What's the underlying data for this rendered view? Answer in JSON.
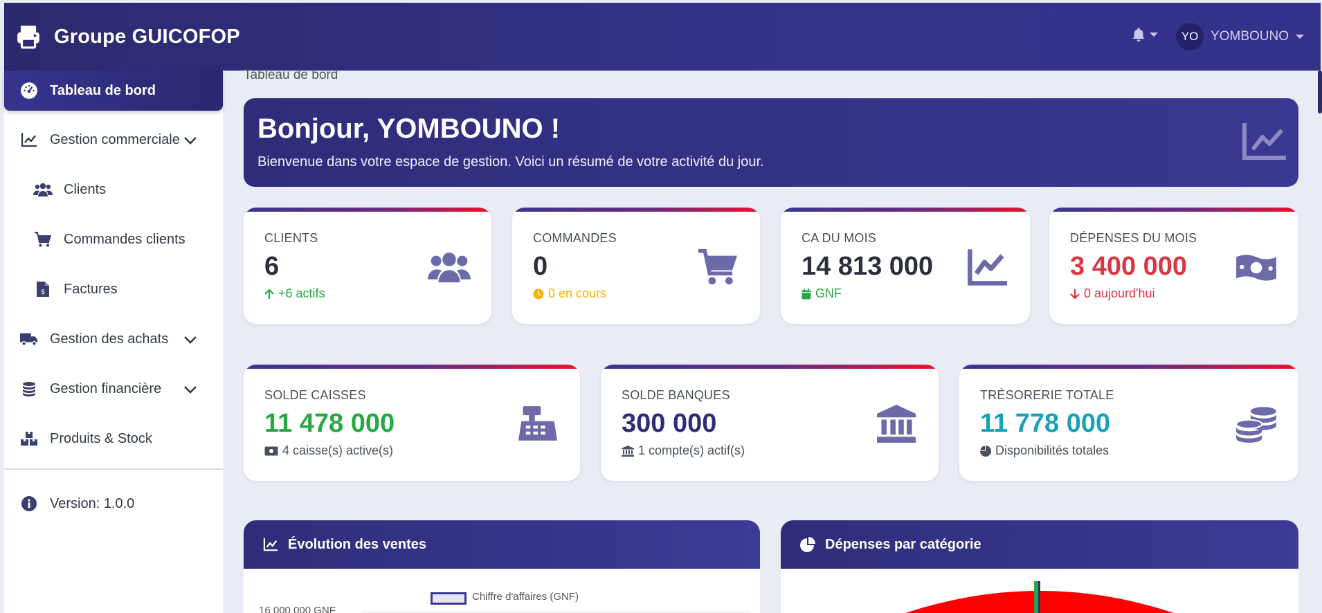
{
  "app": {
    "brand": "Groupe GUICOFOP",
    "user_initials": "YO",
    "user_name": "YOMBOUNO"
  },
  "sidebar": {
    "active": "Tableau de bord",
    "items": [
      {
        "label": "Gestion commerciale",
        "icon": "chart-line-icon"
      },
      {
        "label": "Clients",
        "icon": "users-icon"
      },
      {
        "label": "Commandes clients",
        "icon": "cart-icon"
      },
      {
        "label": "Factures",
        "icon": "invoice-icon"
      },
      {
        "label": "Gestion des achats",
        "icon": "truck-icon"
      },
      {
        "label": "Gestion financière",
        "icon": "coins-icon"
      },
      {
        "label": "Produits & Stock",
        "icon": "boxes-icon"
      }
    ],
    "version": "Version: 1.0.0"
  },
  "breadcrumb": "Tableau de bord",
  "hero": {
    "title": "Bonjour, YOMBOUNO !",
    "subtitle": "Bienvenue dans votre espace de gestion. Voici un résumé de votre activité du jour."
  },
  "stats": [
    {
      "label": "CLIENTS",
      "value": "6",
      "sub": "+6 actifs",
      "color": "#28a745",
      "icon": "users-icon"
    },
    {
      "label": "COMMANDES",
      "value": "0",
      "sub": "0 en cours",
      "color": "#f5b400",
      "icon": "cart-icon"
    },
    {
      "label": "CA DU MOIS",
      "value": "14 813 000",
      "sub": "GNF",
      "color": "#28a745",
      "icon": "chart-line-icon"
    },
    {
      "label": "DÉPENSES DU MOIS",
      "value": "3 400 000",
      "sub": "0 aujourd'hui",
      "color": "#dc3545",
      "icon": "money-icon"
    }
  ],
  "finance": [
    {
      "label": "SOLDE CAISSES",
      "value": "11 478 000",
      "sub": "4 caisse(s) active(s)",
      "color": "#28a745",
      "icon": "cash-register-icon"
    },
    {
      "label": "SOLDE BANQUES",
      "value": "300 000",
      "sub": "1 compte(s) actif(s)",
      "color": "#2f2d7a",
      "icon": "bank-icon"
    },
    {
      "label": "TRÉSORERIE TOTALE",
      "value": "11 778 000",
      "sub": "Disponibilités totales",
      "color": "#17a2b8",
      "icon": "coins-icon"
    }
  ],
  "panels": {
    "sales_title": "Évolution des ventes",
    "expenses_title": "Dépenses par catégorie"
  },
  "chart_data": {
    "type": "line",
    "legend": [
      "Chiffre d'affaires (GNF)"
    ],
    "y_tick_top": "16 000 000 GNF"
  },
  "colors": {
    "primary": "#2f2d7a",
    "accent_red": "#e8122a"
  }
}
